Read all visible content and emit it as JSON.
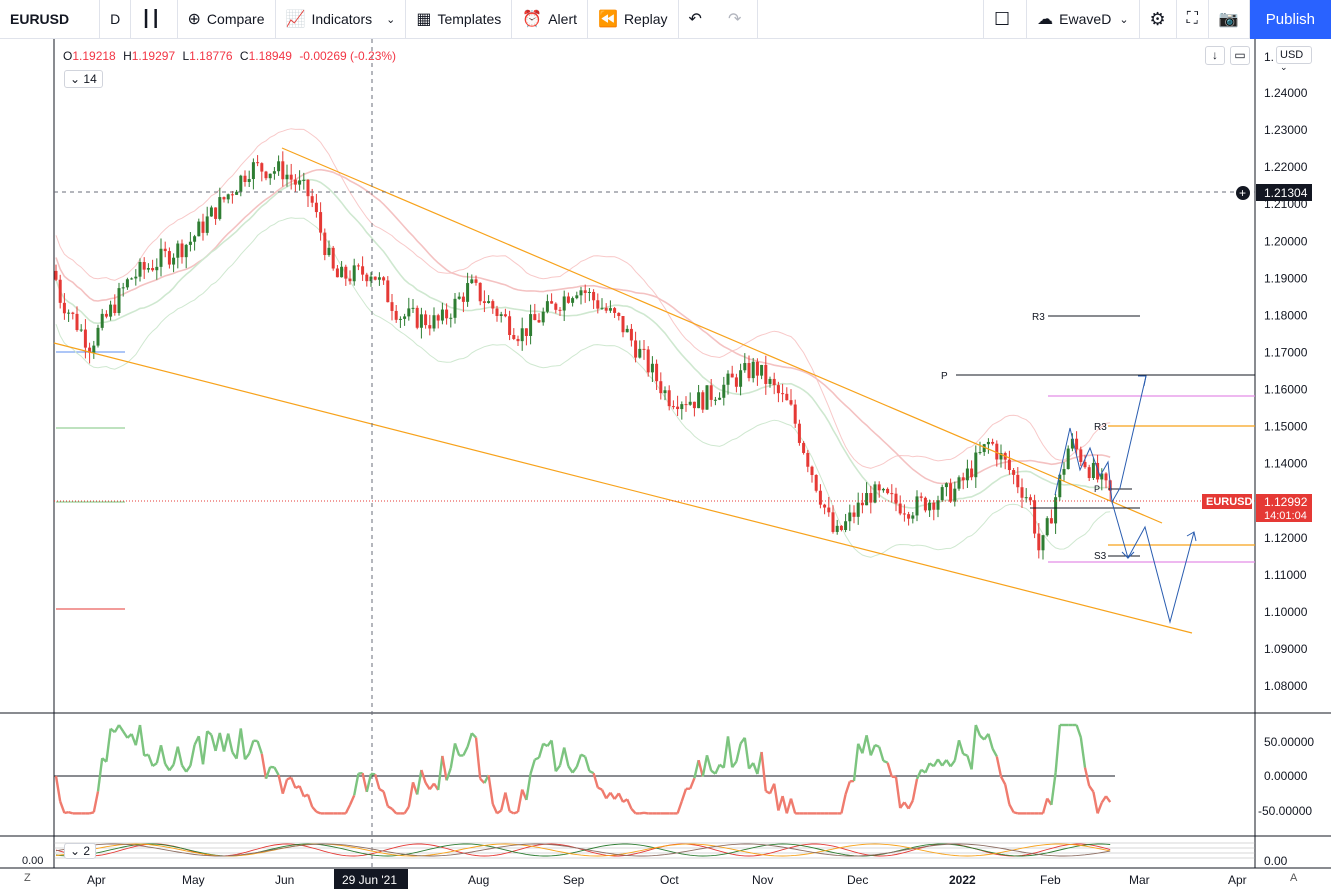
{
  "toolbar": {
    "symbol": "EURUSD",
    "interval": "D",
    "compare": "Compare",
    "indicators": "Indicators",
    "templates": "Templates",
    "alert": "Alert",
    "replay": "Replay",
    "layout_name": "EwaveD",
    "publish": "Publish"
  },
  "legend": {
    "o_label": "O",
    "o": "1.19218",
    "h_label": "H",
    "h": "1.19297",
    "l_label": "L",
    "l": "1.18776",
    "c_label": "C",
    "c": "1.18949",
    "change": "-0.00269 (-0.23%)",
    "indicator_badge": "14",
    "indicator_badge2": "2"
  },
  "price_scale": {
    "currency": "USD",
    "labels": [
      "1.24000",
      "1.23000",
      "1.22000",
      "1.21000",
      "1.20000",
      "1.19000",
      "1.18000",
      "1.17000",
      "1.16000",
      "1.15000",
      "1.14000",
      "1.13000",
      "1.12000",
      "1.11000",
      "1.10000",
      "1.09000",
      "1.08000"
    ],
    "top_partial": "1.",
    "crosshair_price": "1.21304",
    "last_symbol": "EURUSD",
    "last_price": "1.12992",
    "countdown": "14:01:04"
  },
  "osc_scale": {
    "labels": [
      "50.00000",
      "0.00000",
      "-50.00000"
    ],
    "osc2_label": "0.00",
    "osc2_left": "0.00"
  },
  "time_axis": {
    "labels": [
      "Apr",
      "May",
      "Jun",
      "Aug",
      "Sep",
      "Oct",
      "Nov",
      "Dec",
      "2022",
      "Feb",
      "Mar",
      "Apr"
    ],
    "crosshair_date": "29 Jun '21",
    "left_corner": "Z",
    "right_corner": "A"
  },
  "pivot_labels": {
    "r3_upper": "R3",
    "p": "P",
    "r3": "R3",
    "pivot_small": "P",
    "s3": "S3"
  },
  "colors": {
    "up": "#2e7d32",
    "down": "#e53935",
    "fib_orange": "#f7a21b",
    "accent": "#2962ff",
    "bb_red": "#f8bbbb",
    "bb_green": "#c8e6c9",
    "ma_pink": "#f4c2c2"
  },
  "chart_data": {
    "type": "candlestick",
    "symbol": "EURUSD",
    "interval": "D",
    "ylim": [
      1.075,
      1.252
    ],
    "monthly_path": [
      [
        "Mar 31",
        1.193
      ],
      [
        "Apr 1",
        1.171
      ],
      [
        "Apr 15",
        1.196
      ],
      [
        "May 5",
        1.205
      ],
      [
        "May 25",
        1.222
      ],
      [
        "Jun 10",
        1.218
      ],
      [
        "Jun 29",
        1.189
      ],
      [
        "Jul 20",
        1.18
      ],
      [
        "Aug 10",
        1.173
      ],
      [
        "Aug 31",
        1.183
      ],
      [
        "Sep 20",
        1.172
      ],
      [
        "Oct 10",
        1.155
      ],
      [
        "Oct 28",
        1.168
      ],
      [
        "Nov 24",
        1.12
      ],
      [
        "Dec 15",
        1.13
      ],
      [
        "Jan 13",
        1.147
      ],
      [
        "Jan 28",
        1.115
      ],
      [
        "Feb 10",
        1.145
      ],
      [
        "Feb 22",
        1.13
      ]
    ],
    "last_close": 1.12992,
    "pivots": {
      "R3_upper": 1.18,
      "P": 1.164,
      "R3": 1.15,
      "S3": 1.114
    },
    "oscillator_range": [
      -55,
      90
    ]
  }
}
